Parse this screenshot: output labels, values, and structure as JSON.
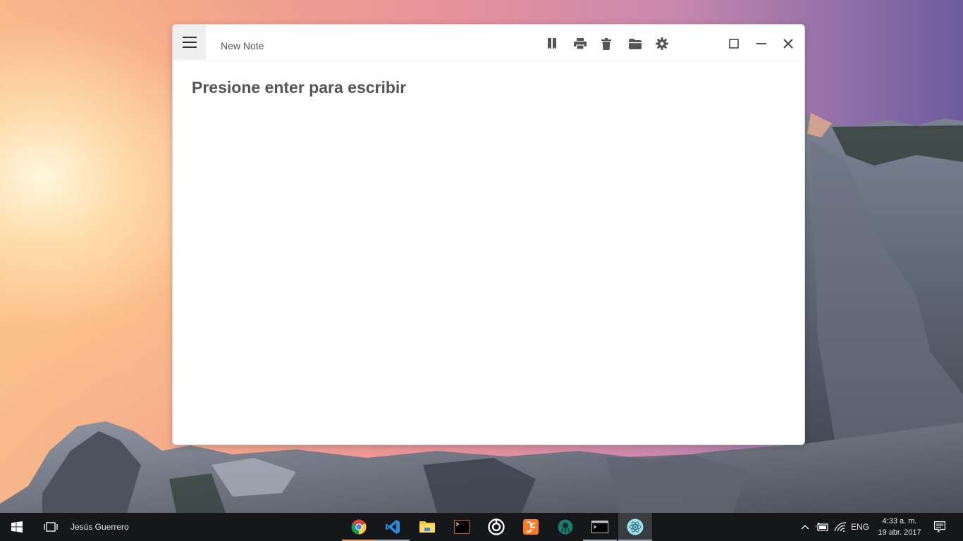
{
  "window": {
    "title": "New Note",
    "placeholder_heading": "Presione enter para escribir",
    "toolbar_icons": [
      "bookmark-icon",
      "print-icon",
      "trash-icon",
      "folder-icon",
      "settings-icon"
    ],
    "window_controls": [
      "maximize-icon",
      "minimize-icon",
      "close-icon"
    ]
  },
  "taskbar": {
    "user_name": "Jesús Guerrero",
    "apps": [
      "chrome",
      "visual-studio-code",
      "file-explorer",
      "terminal",
      "media-app",
      "xampp",
      "gitkraken",
      "command-prompt",
      "electron"
    ],
    "tray": {
      "language": "ENG",
      "time": "4:33 a. m.",
      "date": "19 abr. 2017"
    }
  },
  "colors": {
    "taskbar_bg": "#16171b",
    "window_bg": "#ffffff",
    "heading_text": "#555555"
  }
}
